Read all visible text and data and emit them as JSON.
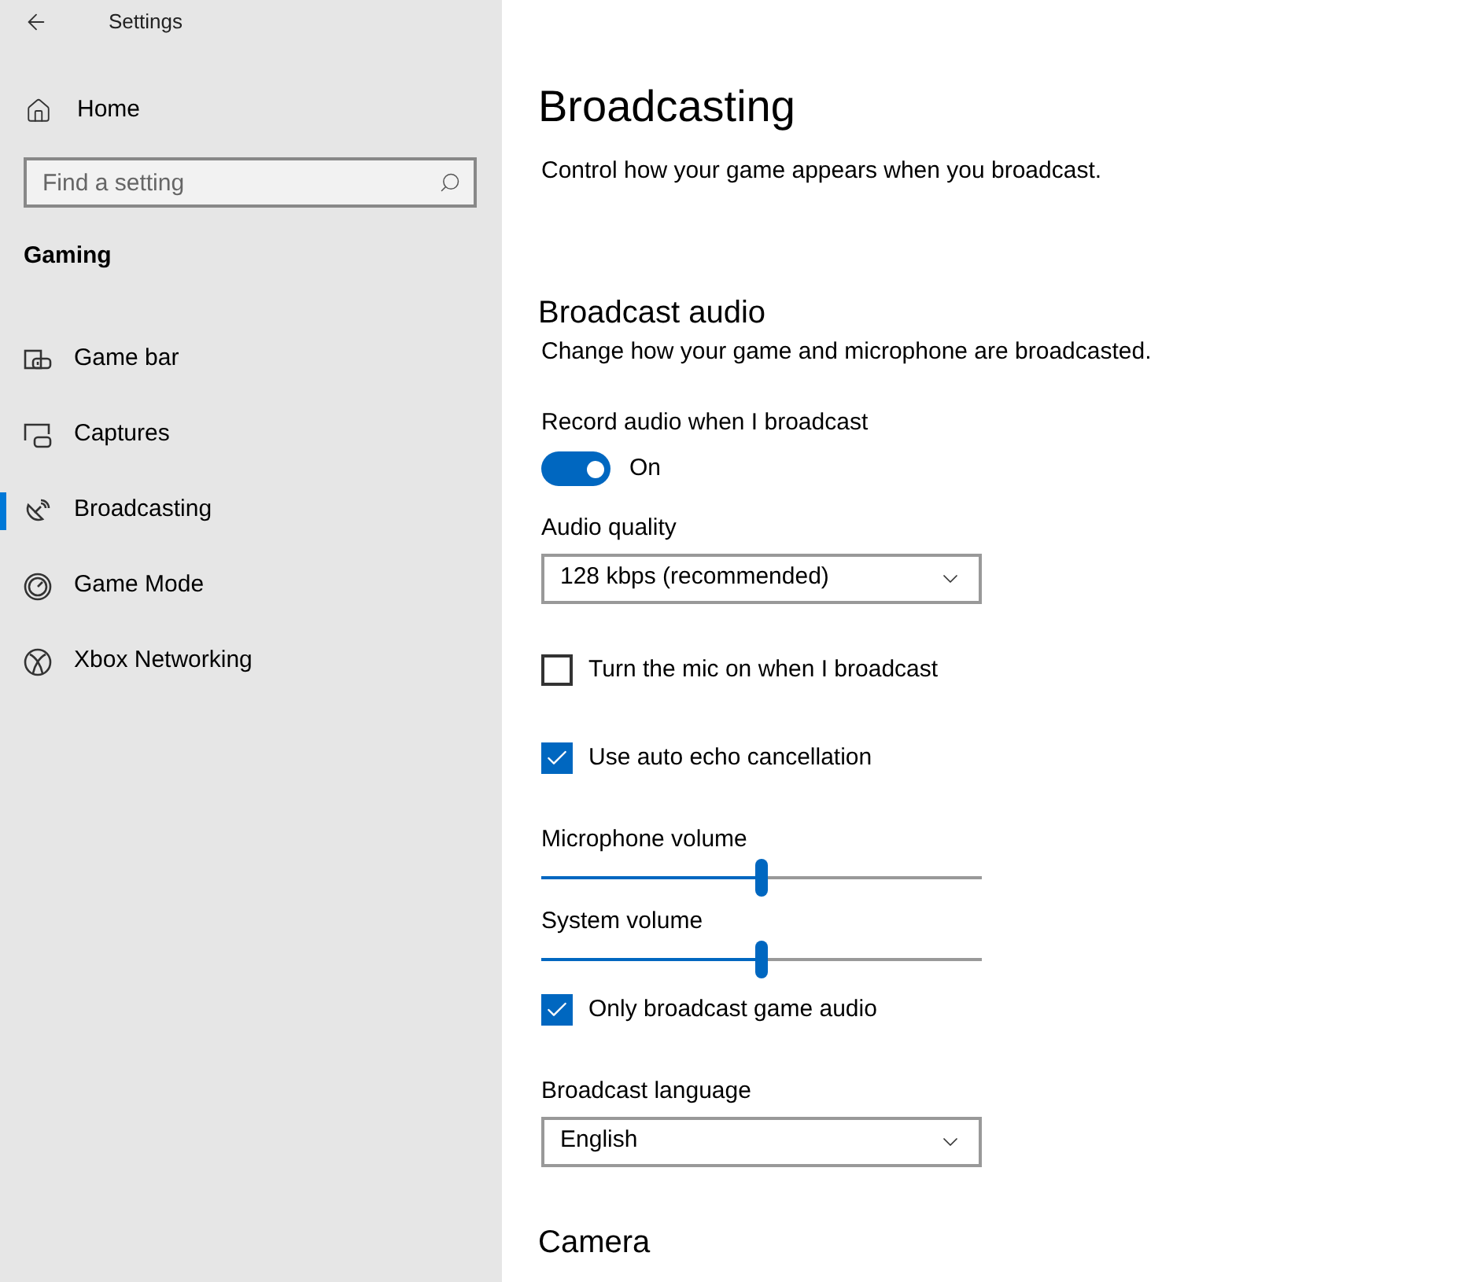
{
  "window": {
    "title": "Settings"
  },
  "sidebar": {
    "home": "Home",
    "search": {
      "placeholder": "Find a setting"
    },
    "section": "Gaming",
    "items": [
      {
        "label": "Game bar",
        "selected": false
      },
      {
        "label": "Captures",
        "selected": false
      },
      {
        "label": "Broadcasting",
        "selected": true
      },
      {
        "label": "Game Mode",
        "selected": false
      },
      {
        "label": "Xbox Networking",
        "selected": false
      }
    ]
  },
  "page": {
    "title": "Broadcasting",
    "description": "Control how your game appears when you broadcast.",
    "section": {
      "title": "Broadcast audio",
      "description": "Change how your game and microphone are broadcasted."
    },
    "settings": [
      {
        "kind": "toggle",
        "label": "Record audio when I broadcast",
        "on": true,
        "state_text": "On"
      },
      {
        "kind": "dropdown",
        "label": "Audio quality",
        "value": "128 kbps (recommended)"
      },
      {
        "kind": "checkbox",
        "label": "Turn the mic on when I broadcast",
        "checked": false
      },
      {
        "kind": "checkbox",
        "label": "Use auto echo cancellation",
        "checked": true
      },
      {
        "kind": "slider",
        "label": "Microphone volume",
        "level": 0.5
      },
      {
        "kind": "slider",
        "label": "System volume",
        "level": 0.5
      },
      {
        "kind": "checkbox",
        "label": "Only broadcast game audio",
        "checked": true
      },
      {
        "kind": "dropdown",
        "label": "Broadcast language",
        "value": "English"
      }
    ],
    "next_section": "Camera"
  }
}
